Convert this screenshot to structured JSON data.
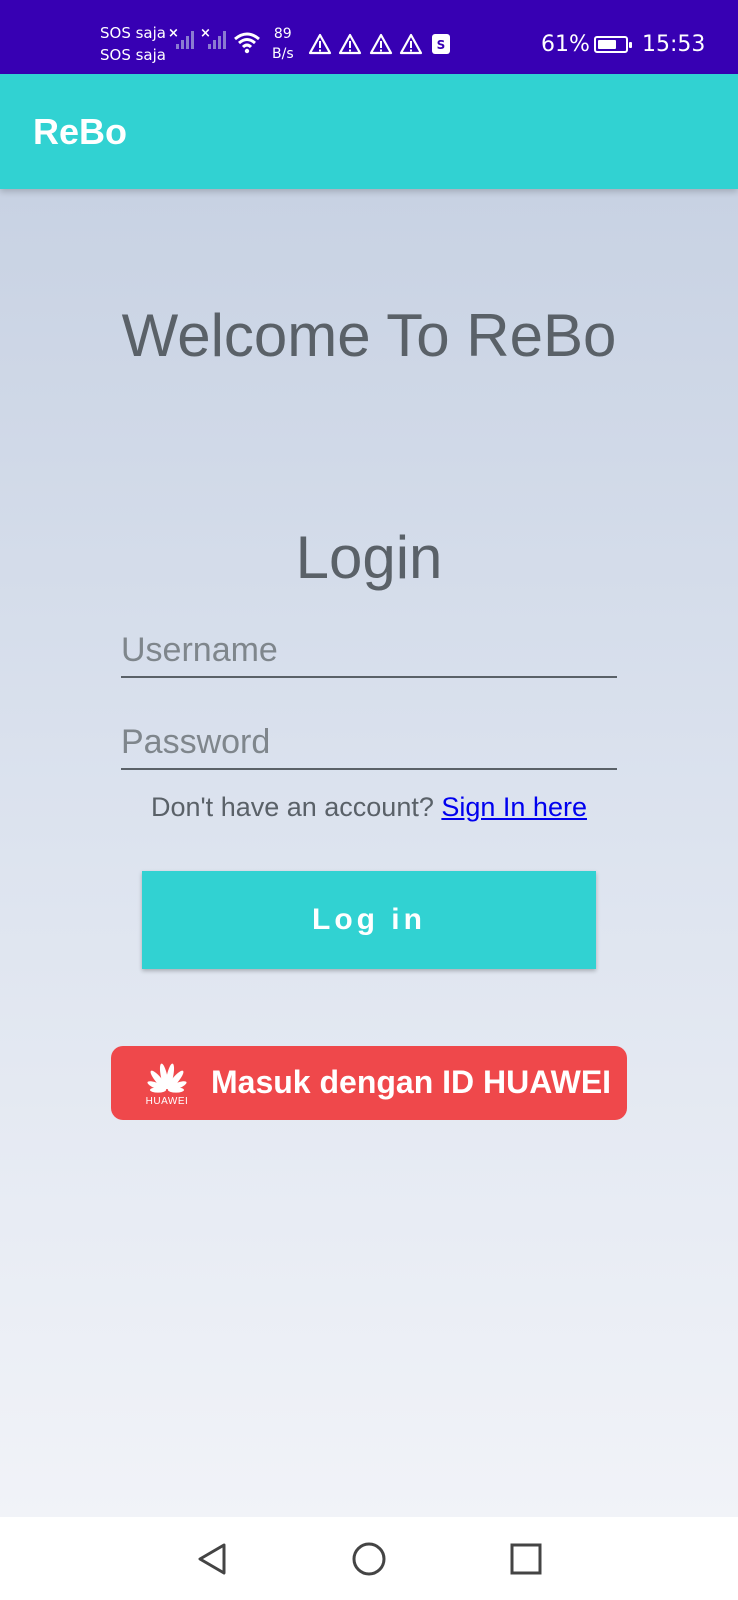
{
  "status_bar": {
    "carrier_1": "SOS saja",
    "carrier_2": "SOS saja",
    "net_speed_value": "89",
    "net_speed_unit": "B/s",
    "battery": "61%",
    "battery_level": 0.61,
    "time": "15:53",
    "background": "#3700b3"
  },
  "app_bar": {
    "title": "ReBo",
    "color": "#31d2d2"
  },
  "main": {
    "welcome": "Welcome To ReBo",
    "login_title": "Login",
    "username_placeholder": "Username",
    "username_value": "",
    "password_placeholder": "Password",
    "password_value": "",
    "no_account_text": "Don't have an account?",
    "sign_in_link": "Sign In here",
    "login_button": "Log in",
    "huawei_button": "Masuk dengan ID HUAWEI",
    "huawei_brand": "HUAWEI",
    "huawei_color": "#ef484b"
  },
  "nav_bar": {
    "back_icon": "back-triangle-icon",
    "home_icon": "home-circle-icon",
    "recents_icon": "recents-square-icon"
  }
}
